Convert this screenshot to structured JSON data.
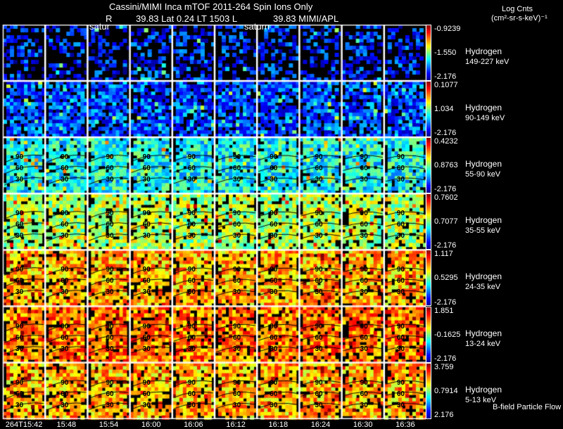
{
  "header": {
    "line1": "Cassini/MIMI Inca mTOF  2011-264   Spin   Ions Only",
    "line2_r": "R",
    "line2_mid": "39.83 Lat 0.24 LT 1503 L",
    "line2_end": "39.83  MIMI/APL",
    "annot1": "satur",
    "annot2": "saturn"
  },
  "units": {
    "line1": "Log Cnts",
    "line2": "(cm²-sr-s-keV)⁻¹"
  },
  "footer_note": "B-field Particle Flow",
  "chart_data": {
    "type": "heatmap",
    "colormap": "jet",
    "time_labels": [
      "264T15:42",
      "15:48",
      "15:54",
      "16:00",
      "16:06",
      "16:12",
      "16:18",
      "16:24",
      "16:30",
      "16:36"
    ],
    "contour_labels": [
      "30",
      "60",
      "90",
      "120"
    ],
    "rows": [
      {
        "species": "Hydrogen",
        "energy": "149-227 keV",
        "max": "-0.9239",
        "mid": "-1.550",
        "min": "-2.176",
        "level": 0.15,
        "fill": 0.4,
        "contours": false
      },
      {
        "species": "Hydrogen",
        "energy": "90-149 keV",
        "max": "0.1077",
        "mid": "1.034",
        "min": "-2.176",
        "level": 0.2,
        "fill": 0.8,
        "contours": false
      },
      {
        "species": "Hydrogen",
        "energy": "55-90 keV",
        "max": "0.4232",
        "mid": "0.8763",
        "min": "-2.176",
        "level": 0.38,
        "fill": 0.9,
        "contours": true
      },
      {
        "species": "Hydrogen",
        "energy": "35-55 keV",
        "max": "0.7602",
        "mid": "0.7077",
        "min": "-2.176",
        "level": 0.55,
        "fill": 0.85,
        "contours": true
      },
      {
        "species": "Hydrogen",
        "energy": "24-35 keV",
        "max": "1.117",
        "mid": "0.5295",
        "min": "-2.176",
        "level": 0.7,
        "fill": 0.85,
        "contours": true
      },
      {
        "species": "Hydrogen",
        "energy": "13-24 keV",
        "max": "1.851",
        "mid": "-0.1625",
        "min": "-2.176",
        "level": 0.76,
        "fill": 0.85,
        "contours": true
      },
      {
        "species": "Hydrogen",
        "energy": "5-13 keV",
        "max": "3.759",
        "mid": "0.7914",
        "min": "2.176",
        "level": 0.7,
        "fill": 0.85,
        "contours": true
      }
    ]
  }
}
